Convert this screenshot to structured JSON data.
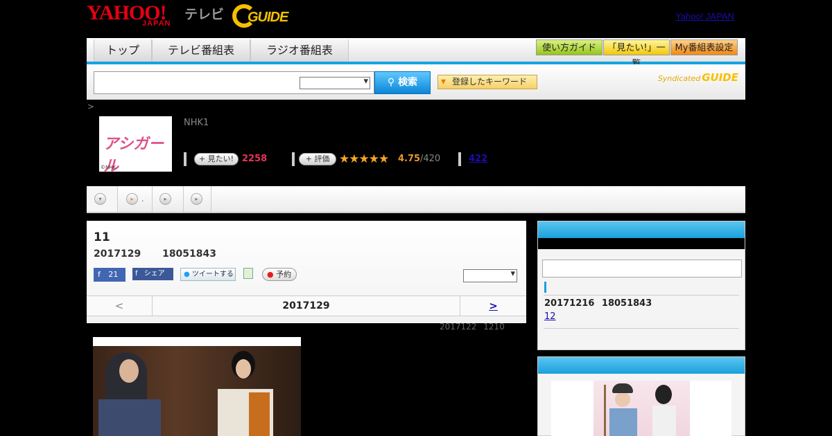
{
  "header": {
    "logo_yahoo": "YAHOO!",
    "logo_japan": "JAPAN",
    "logo_tv": "テレビ",
    "logo_gguide": "GUIDE",
    "yahoo_japan_link": "Yahoo! JAPAN"
  },
  "nav": {
    "tabs": [
      {
        "label": "トップ"
      },
      {
        "label": "テレビ番組表"
      },
      {
        "label": "ラジオ番組表"
      }
    ],
    "right_buttons": [
      {
        "label": "使い方ガイド",
        "color": "#97c41c"
      },
      {
        "label": "「見たい!」一覧",
        "color": "#f2c80a"
      },
      {
        "label": "My番組表設定",
        "color": "#f08a12"
      }
    ]
  },
  "search": {
    "input_value": "",
    "search_button": "検索",
    "keyword_button": "登録したキーワード",
    "syndicated_label": "Syndicated",
    "syndicated_logo": "GUIDE"
  },
  "program": {
    "breadcrumb": ">",
    "channel": "NHK1",
    "thumb_title": "アシガール",
    "thumb_copyright": "©NHK",
    "want_button": "見たい!",
    "want_count": "2258",
    "rate_button": "評価",
    "stars": "★★★★★",
    "rating_value": "4.75",
    "rating_total": "/420",
    "review_count": "422"
  },
  "subtabs": [
    {
      "icon": "▾",
      "label": ""
    },
    {
      "icon": "▸",
      "label": "."
    },
    {
      "icon": "▸",
      "label": ""
    },
    {
      "icon": "▸",
      "label": ""
    }
  ],
  "main": {
    "title": "11",
    "subtitle_date": "2017129",
    "subtitle_time": "18051843",
    "fb_like_count": "21",
    "fb_share": "シェア",
    "tweet": "ツイートする",
    "reserve": "予約",
    "pager_prev": "<",
    "pager_date": "2017129",
    "pager_next": ">",
    "update_note_date": "2017122",
    "update_note_time": "1210"
  },
  "sidebar": {
    "next_date": "20171216",
    "next_time": "18051843",
    "next_link": "12"
  },
  "colors": {
    "accent_blue": "#15a3e0",
    "want_red": "#e8335a",
    "star_orange": "#f5a623",
    "link_blue": "#1a0dab"
  }
}
